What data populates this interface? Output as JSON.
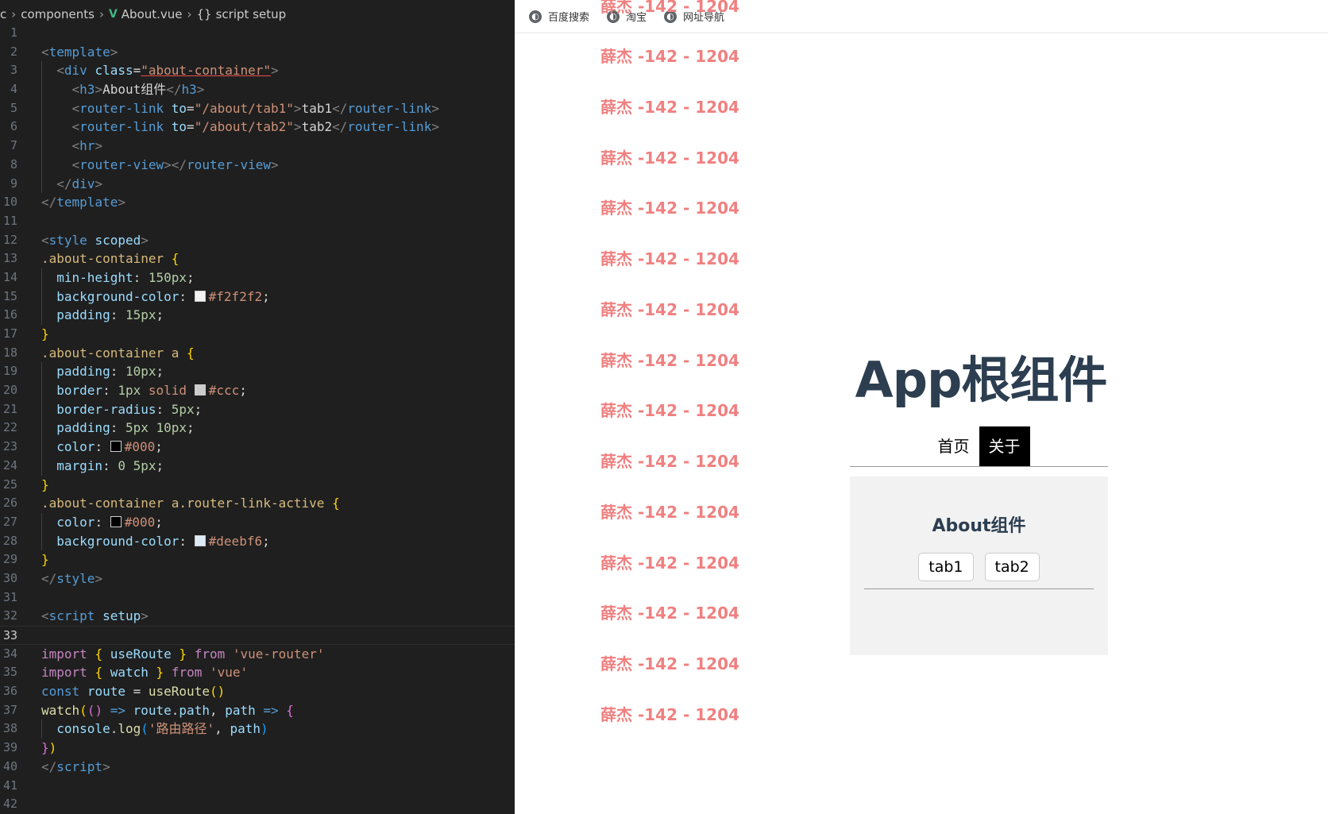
{
  "editor": {
    "breadcrumb": [
      "c",
      "components",
      "About.vue",
      "script setup"
    ],
    "line_numbers": [
      "1",
      "2",
      "3",
      "4",
      "5",
      "6",
      "7",
      "8",
      "9",
      "10",
      "11",
      "12",
      "13",
      "14",
      "15",
      "16",
      "17",
      "18",
      "19",
      "20",
      "21",
      "22",
      "23",
      "24",
      "25",
      "26",
      "27",
      "28",
      "29",
      "30",
      "31",
      "32",
      "33",
      "34",
      "35",
      "36",
      "37",
      "38",
      "39",
      "40",
      "41",
      "42"
    ],
    "current_line": 33,
    "lines": [
      [],
      [
        [
          "<",
          "t-punc"
        ],
        [
          "template",
          "t-tag"
        ],
        [
          ">",
          "t-punc"
        ]
      ],
      [
        [
          "  ",
          "t-text"
        ],
        [
          "<",
          "t-punc"
        ],
        [
          "div",
          "t-tag"
        ],
        [
          " ",
          "t-text"
        ],
        [
          "class",
          "t-attr"
        ],
        [
          "=",
          "t-text"
        ],
        [
          "\"about-container\"",
          "t-str"
        ],
        [
          ">",
          "t-punc"
        ]
      ],
      [
        [
          "    ",
          "t-text"
        ],
        [
          "<",
          "t-punc"
        ],
        [
          "h3",
          "t-tag"
        ],
        [
          ">",
          "t-punc"
        ],
        [
          "About组件",
          "t-text"
        ],
        [
          "</",
          "t-punc"
        ],
        [
          "h3",
          "t-tag"
        ],
        [
          ">",
          "t-punc"
        ]
      ],
      [
        [
          "    ",
          "t-text"
        ],
        [
          "<",
          "t-punc"
        ],
        [
          "router-link",
          "t-tag"
        ],
        [
          " ",
          "t-text"
        ],
        [
          "to",
          "t-attr"
        ],
        [
          "=",
          "t-text"
        ],
        [
          "\"/about/tab1\"",
          "t-str"
        ],
        [
          ">",
          "t-punc"
        ],
        [
          "tab1",
          "t-text"
        ],
        [
          "</",
          "t-punc"
        ],
        [
          "router-link",
          "t-tag"
        ],
        [
          ">",
          "t-punc"
        ]
      ],
      [
        [
          "    ",
          "t-text"
        ],
        [
          "<",
          "t-punc"
        ],
        [
          "router-link",
          "t-tag"
        ],
        [
          " ",
          "t-text"
        ],
        [
          "to",
          "t-attr"
        ],
        [
          "=",
          "t-text"
        ],
        [
          "\"/about/tab2\"",
          "t-str"
        ],
        [
          ">",
          "t-punc"
        ],
        [
          "tab2",
          "t-text"
        ],
        [
          "</",
          "t-punc"
        ],
        [
          "router-link",
          "t-tag"
        ],
        [
          ">",
          "t-punc"
        ]
      ],
      [
        [
          "    ",
          "t-text"
        ],
        [
          "<",
          "t-punc"
        ],
        [
          "hr",
          "t-tag"
        ],
        [
          ">",
          "t-punc"
        ]
      ],
      [
        [
          "    ",
          "t-text"
        ],
        [
          "<",
          "t-punc"
        ],
        [
          "router-view",
          "t-tag"
        ],
        [
          "></",
          "t-punc"
        ],
        [
          "router-view",
          "t-tag"
        ],
        [
          ">",
          "t-punc"
        ]
      ],
      [
        [
          "  ",
          "t-text"
        ],
        [
          "</",
          "t-punc"
        ],
        [
          "div",
          "t-tag"
        ],
        [
          ">",
          "t-punc"
        ]
      ],
      [
        [
          "</",
          "t-punc"
        ],
        [
          "template",
          "t-tag"
        ],
        [
          ">",
          "t-punc"
        ]
      ],
      [],
      [
        [
          "<",
          "t-punc"
        ],
        [
          "style",
          "t-tag"
        ],
        [
          " ",
          "t-text"
        ],
        [
          "scoped",
          "t-attr"
        ],
        [
          ">",
          "t-punc"
        ]
      ],
      [
        [
          ".about-container",
          "t-sel"
        ],
        [
          " ",
          "t-text"
        ],
        [
          "{",
          "t-b1"
        ]
      ],
      [
        [
          "  ",
          "t-text"
        ],
        [
          "min-height",
          "t-prop"
        ],
        [
          ": ",
          "t-text"
        ],
        [
          "150px",
          "t-num"
        ],
        [
          ";",
          "t-text"
        ]
      ],
      [
        [
          "  ",
          "t-text"
        ],
        [
          "background-color",
          "t-prop"
        ],
        [
          ": ",
          "t-text"
        ],
        [
          "#f2f2f2|#f2f2f2",
          "swatch"
        ],
        [
          "#f2f2f2",
          "t-str"
        ],
        [
          ";",
          "t-text"
        ]
      ],
      [
        [
          "  ",
          "t-text"
        ],
        [
          "padding",
          "t-prop"
        ],
        [
          ": ",
          "t-text"
        ],
        [
          "15px",
          "t-num"
        ],
        [
          ";",
          "t-text"
        ]
      ],
      [
        [
          "}",
          "t-b1"
        ]
      ],
      [
        [
          ".about-container a",
          "t-sel"
        ],
        [
          " ",
          "t-text"
        ],
        [
          "{",
          "t-b1"
        ]
      ],
      [
        [
          "  ",
          "t-text"
        ],
        [
          "padding",
          "t-prop"
        ],
        [
          ": ",
          "t-text"
        ],
        [
          "10px",
          "t-num"
        ],
        [
          ";",
          "t-text"
        ]
      ],
      [
        [
          "  ",
          "t-text"
        ],
        [
          "border",
          "t-prop"
        ],
        [
          ": ",
          "t-text"
        ],
        [
          "1px",
          "t-num"
        ],
        [
          " ",
          "t-text"
        ],
        [
          "solid",
          "t-str"
        ],
        [
          " ",
          "t-text"
        ],
        [
          "#ccc|#cccccc",
          "swatch"
        ],
        [
          "#ccc",
          "t-str"
        ],
        [
          ";",
          "t-text"
        ]
      ],
      [
        [
          "  ",
          "t-text"
        ],
        [
          "border-radius",
          "t-prop"
        ],
        [
          ": ",
          "t-text"
        ],
        [
          "5px",
          "t-num"
        ],
        [
          ";",
          "t-text"
        ]
      ],
      [
        [
          "  ",
          "t-text"
        ],
        [
          "padding",
          "t-prop"
        ],
        [
          ": ",
          "t-text"
        ],
        [
          "5px 10px",
          "t-num"
        ],
        [
          ";",
          "t-text"
        ]
      ],
      [
        [
          "  ",
          "t-text"
        ],
        [
          "color",
          "t-prop"
        ],
        [
          ": ",
          "t-text"
        ],
        [
          "#000|#000000",
          "swatch"
        ],
        [
          "#000",
          "t-str"
        ],
        [
          ";",
          "t-text"
        ]
      ],
      [
        [
          "  ",
          "t-text"
        ],
        [
          "margin",
          "t-prop"
        ],
        [
          ": ",
          "t-text"
        ],
        [
          "0 5px",
          "t-num"
        ],
        [
          ";",
          "t-text"
        ]
      ],
      [
        [
          "}",
          "t-b1"
        ]
      ],
      [
        [
          ".about-container a.router-link-active",
          "t-sel"
        ],
        [
          " ",
          "t-text"
        ],
        [
          "{",
          "t-b1"
        ]
      ],
      [
        [
          "  ",
          "t-text"
        ],
        [
          "color",
          "t-prop"
        ],
        [
          ": ",
          "t-text"
        ],
        [
          "#000|#000000",
          "swatch"
        ],
        [
          "#000",
          "t-str"
        ],
        [
          ";",
          "t-text"
        ]
      ],
      [
        [
          "  ",
          "t-text"
        ],
        [
          "background-color",
          "t-prop"
        ],
        [
          ": ",
          "t-text"
        ],
        [
          "#deebf6|#deebf6",
          "swatch"
        ],
        [
          "#deebf6",
          "t-str"
        ],
        [
          ";",
          "t-text"
        ]
      ],
      [
        [
          "}",
          "t-b1"
        ]
      ],
      [
        [
          "</",
          "t-punc"
        ],
        [
          "style",
          "t-tag"
        ],
        [
          ">",
          "t-punc"
        ]
      ],
      [],
      [
        [
          "<",
          "t-punc"
        ],
        [
          "script",
          "t-tag"
        ],
        [
          " ",
          "t-text"
        ],
        [
          "setup",
          "t-attr"
        ],
        [
          ">",
          "t-punc"
        ]
      ],
      [],
      [
        [
          "import",
          "t-kw"
        ],
        [
          " ",
          "t-text"
        ],
        [
          "{",
          "t-b1"
        ],
        [
          " ",
          "t-text"
        ],
        [
          "useRoute",
          "t-var"
        ],
        [
          " ",
          "t-text"
        ],
        [
          "}",
          "t-b1"
        ],
        [
          " ",
          "t-text"
        ],
        [
          "from",
          "t-kw"
        ],
        [
          " ",
          "t-text"
        ],
        [
          "'vue-router'",
          "t-str"
        ]
      ],
      [
        [
          "import",
          "t-kw"
        ],
        [
          " ",
          "t-text"
        ],
        [
          "{",
          "t-b1"
        ],
        [
          " ",
          "t-text"
        ],
        [
          "watch",
          "t-var"
        ],
        [
          " ",
          "t-text"
        ],
        [
          "}",
          "t-b1"
        ],
        [
          " ",
          "t-text"
        ],
        [
          "from",
          "t-kw"
        ],
        [
          " ",
          "t-text"
        ],
        [
          "'vue'",
          "t-str"
        ]
      ],
      [
        [
          "const",
          "t-const"
        ],
        [
          " ",
          "t-text"
        ],
        [
          "route",
          "t-var"
        ],
        [
          " = ",
          "t-text"
        ],
        [
          "useRoute",
          "t-fn"
        ],
        [
          "()",
          "t-b1"
        ]
      ],
      [
        [
          "watch",
          "t-fn"
        ],
        [
          "(",
          "t-b1"
        ],
        [
          "()",
          "t-b2"
        ],
        [
          " => ",
          "t-const"
        ],
        [
          "route",
          "t-var"
        ],
        [
          ".",
          "t-text"
        ],
        [
          "path",
          "t-var"
        ],
        [
          ", ",
          "t-text"
        ],
        [
          "path",
          "t-var"
        ],
        [
          " => ",
          "t-const"
        ],
        [
          "{",
          "t-b2"
        ]
      ],
      [
        [
          "  ",
          "t-text"
        ],
        [
          "console",
          "t-var"
        ],
        [
          ".",
          "t-text"
        ],
        [
          "log",
          "t-fn"
        ],
        [
          "(",
          "t-b3"
        ],
        [
          "'路由路径'",
          "t-str"
        ],
        [
          ", ",
          "t-text"
        ],
        [
          "path",
          "t-var"
        ],
        [
          ")",
          "t-b3"
        ]
      ],
      [
        [
          "}",
          "t-b2"
        ],
        [
          ")",
          "t-b1"
        ]
      ],
      [
        [
          "</",
          "t-punc"
        ],
        [
          "script",
          "t-tag"
        ],
        [
          ">",
          "t-punc"
        ]
      ],
      [],
      []
    ]
  },
  "browser": {
    "bookmarks": [
      {
        "label": "百度搜索",
        "icon": "globe-icon"
      },
      {
        "label": "淘宝",
        "icon": "globe-icon"
      },
      {
        "label": "网址导航",
        "icon": "globe-icon"
      }
    ],
    "watermark_text": "薛杰 -142 - 1204",
    "watermark_color": "#f08080",
    "app_title": "App根组件",
    "nav": [
      {
        "label": "首页",
        "active": false
      },
      {
        "label": "关于",
        "active": true
      }
    ],
    "about_title": "About组件",
    "tabs": [
      "tab1",
      "tab2"
    ]
  }
}
